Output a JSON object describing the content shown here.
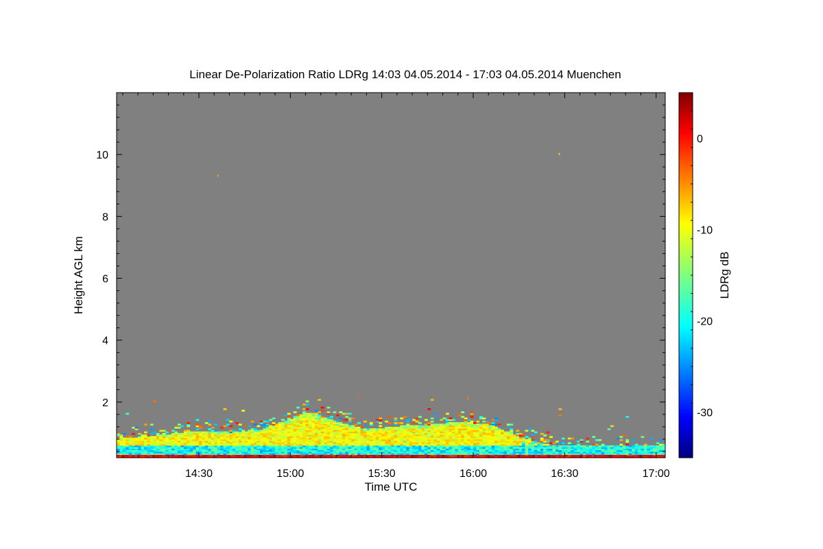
{
  "chart_data": {
    "type": "heatmap",
    "title": "Linear De-Polarization Ratio LDRg   14:03 04.05.2014 - 17:03 04.05.2014 Muenchen",
    "xlabel": "Time UTC",
    "ylabel": "Height AGL km",
    "colorbar_label": "LDRg dB",
    "x_range": [
      "14:03",
      "17:03"
    ],
    "y_range": [
      0.2,
      12.0
    ],
    "x_ticks": [
      "14:30",
      "15:00",
      "15:30",
      "16:00",
      "16:30",
      "17:00"
    ],
    "y_ticks": [
      "2",
      "4",
      "6",
      "8",
      "10"
    ],
    "colorbar_range": [
      -35,
      5
    ],
    "colorbar_ticks": [
      "0",
      "-10",
      "-20",
      "-30"
    ],
    "colormap": "jet",
    "background_color": "#808080",
    "aerosol_layer_top_km": [
      {
        "time": "14:03",
        "top": 0.8
      },
      {
        "time": "14:15",
        "top": 0.9
      },
      {
        "time": "14:30",
        "top": 1.05
      },
      {
        "time": "14:40",
        "top": 1.0
      },
      {
        "time": "14:50",
        "top": 1.1
      },
      {
        "time": "15:00",
        "top": 1.45
      },
      {
        "time": "15:05",
        "top": 1.65
      },
      {
        "time": "15:15",
        "top": 1.35
      },
      {
        "time": "15:25",
        "top": 1.1
      },
      {
        "time": "15:35",
        "top": 1.2
      },
      {
        "time": "15:45",
        "top": 1.25
      },
      {
        "time": "15:55",
        "top": 1.35
      },
      {
        "time": "16:05",
        "top": 1.25
      },
      {
        "time": "16:15",
        "top": 0.85
      },
      {
        "time": "16:25",
        "top": 0.6
      },
      {
        "time": "16:35",
        "top": 0.5
      },
      {
        "time": "17:03",
        "top": 0.45
      }
    ]
  }
}
